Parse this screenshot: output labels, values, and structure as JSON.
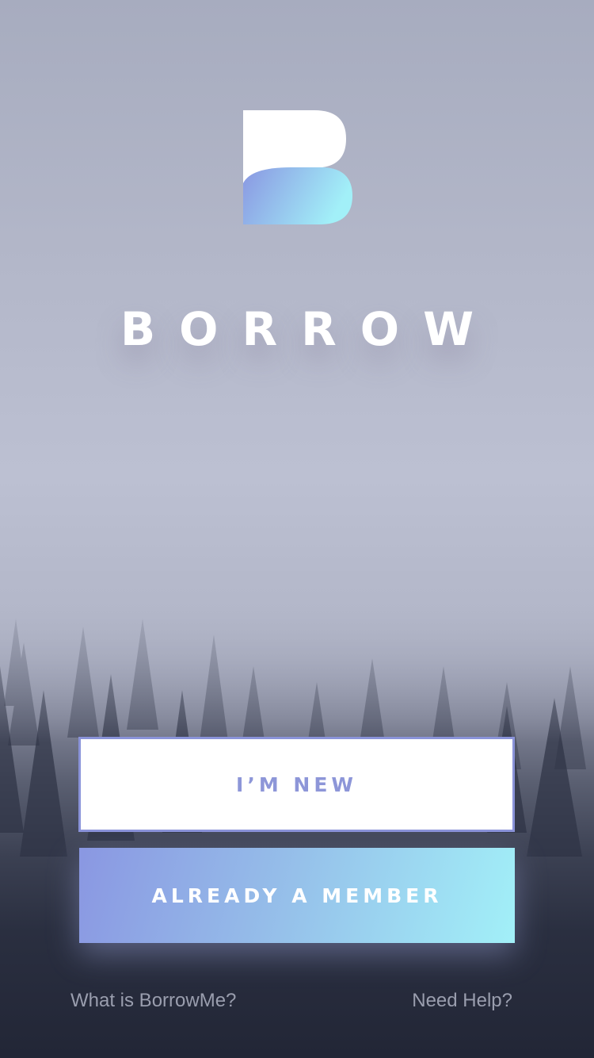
{
  "brand": {
    "name": "BORROW",
    "logo_icon": "borrow-b-logo",
    "gradient_start": "#8a97e2",
    "gradient_end": "#a2f0f8"
  },
  "actions": {
    "new_label": "I’M NEW",
    "member_label": "ALREADY A MEMBER"
  },
  "footer": {
    "about_label": "What is BorrowMe?",
    "help_label": "Need Help?"
  },
  "colors": {
    "accent": "#8d96d8",
    "background_top": "#a7acbf",
    "background_bottom": "#222636"
  }
}
